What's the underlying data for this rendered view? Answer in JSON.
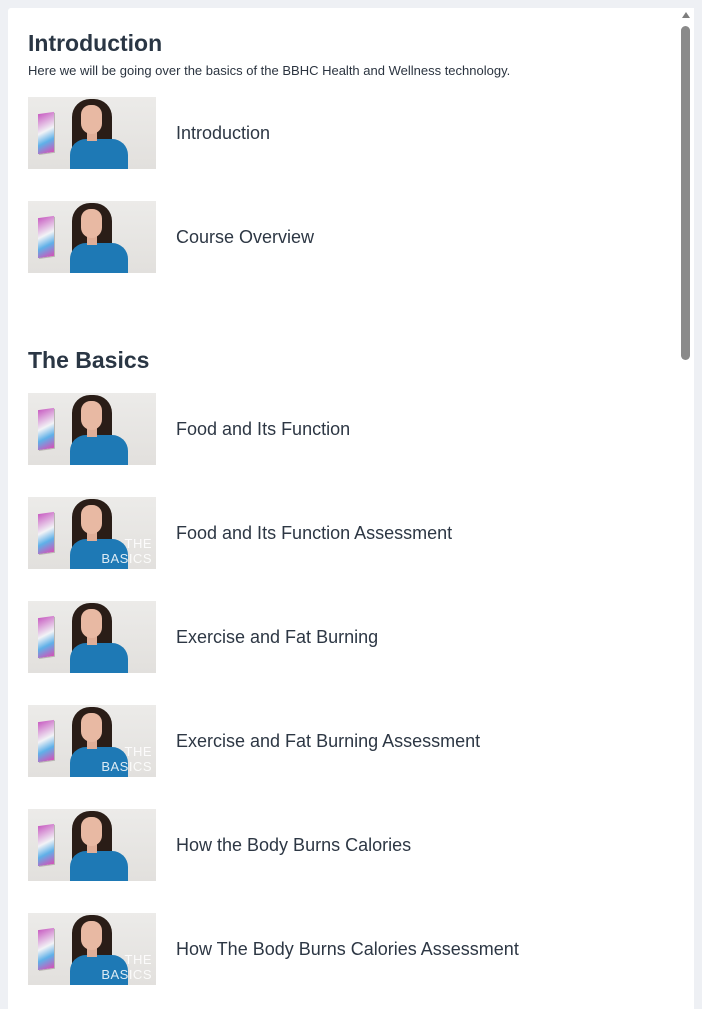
{
  "sections": [
    {
      "title": "Introduction",
      "description": "Here we will be going over the basics of the BBHC Health and Wellness technology.",
      "lessons": [
        {
          "title": "Introduction",
          "thumbnail_overlay": ""
        },
        {
          "title": "Course Overview",
          "thumbnail_overlay": ""
        }
      ]
    },
    {
      "title": "The Basics",
      "description": "",
      "lessons": [
        {
          "title": "Food and Its Function",
          "thumbnail_overlay": ""
        },
        {
          "title": "Food and Its Function Assessment",
          "thumbnail_overlay": "THE BASICS"
        },
        {
          "title": "Exercise and Fat Burning",
          "thumbnail_overlay": ""
        },
        {
          "title": "Exercise and Fat Burning Assessment",
          "thumbnail_overlay": "THE BASICS"
        },
        {
          "title": "How the Body Burns Calories",
          "thumbnail_overlay": ""
        },
        {
          "title": "How The Body Burns Calories Assessment",
          "thumbnail_overlay": "THE BASICS"
        }
      ]
    }
  ],
  "icons": {
    "scroll_up": "triangle-up-icon"
  },
  "colors": {
    "page_background": "#eef0f4",
    "panel_background": "#ffffff",
    "heading": "#2a3644",
    "text": "#2d3744",
    "scroll_thumb": "#8a8a8a"
  }
}
